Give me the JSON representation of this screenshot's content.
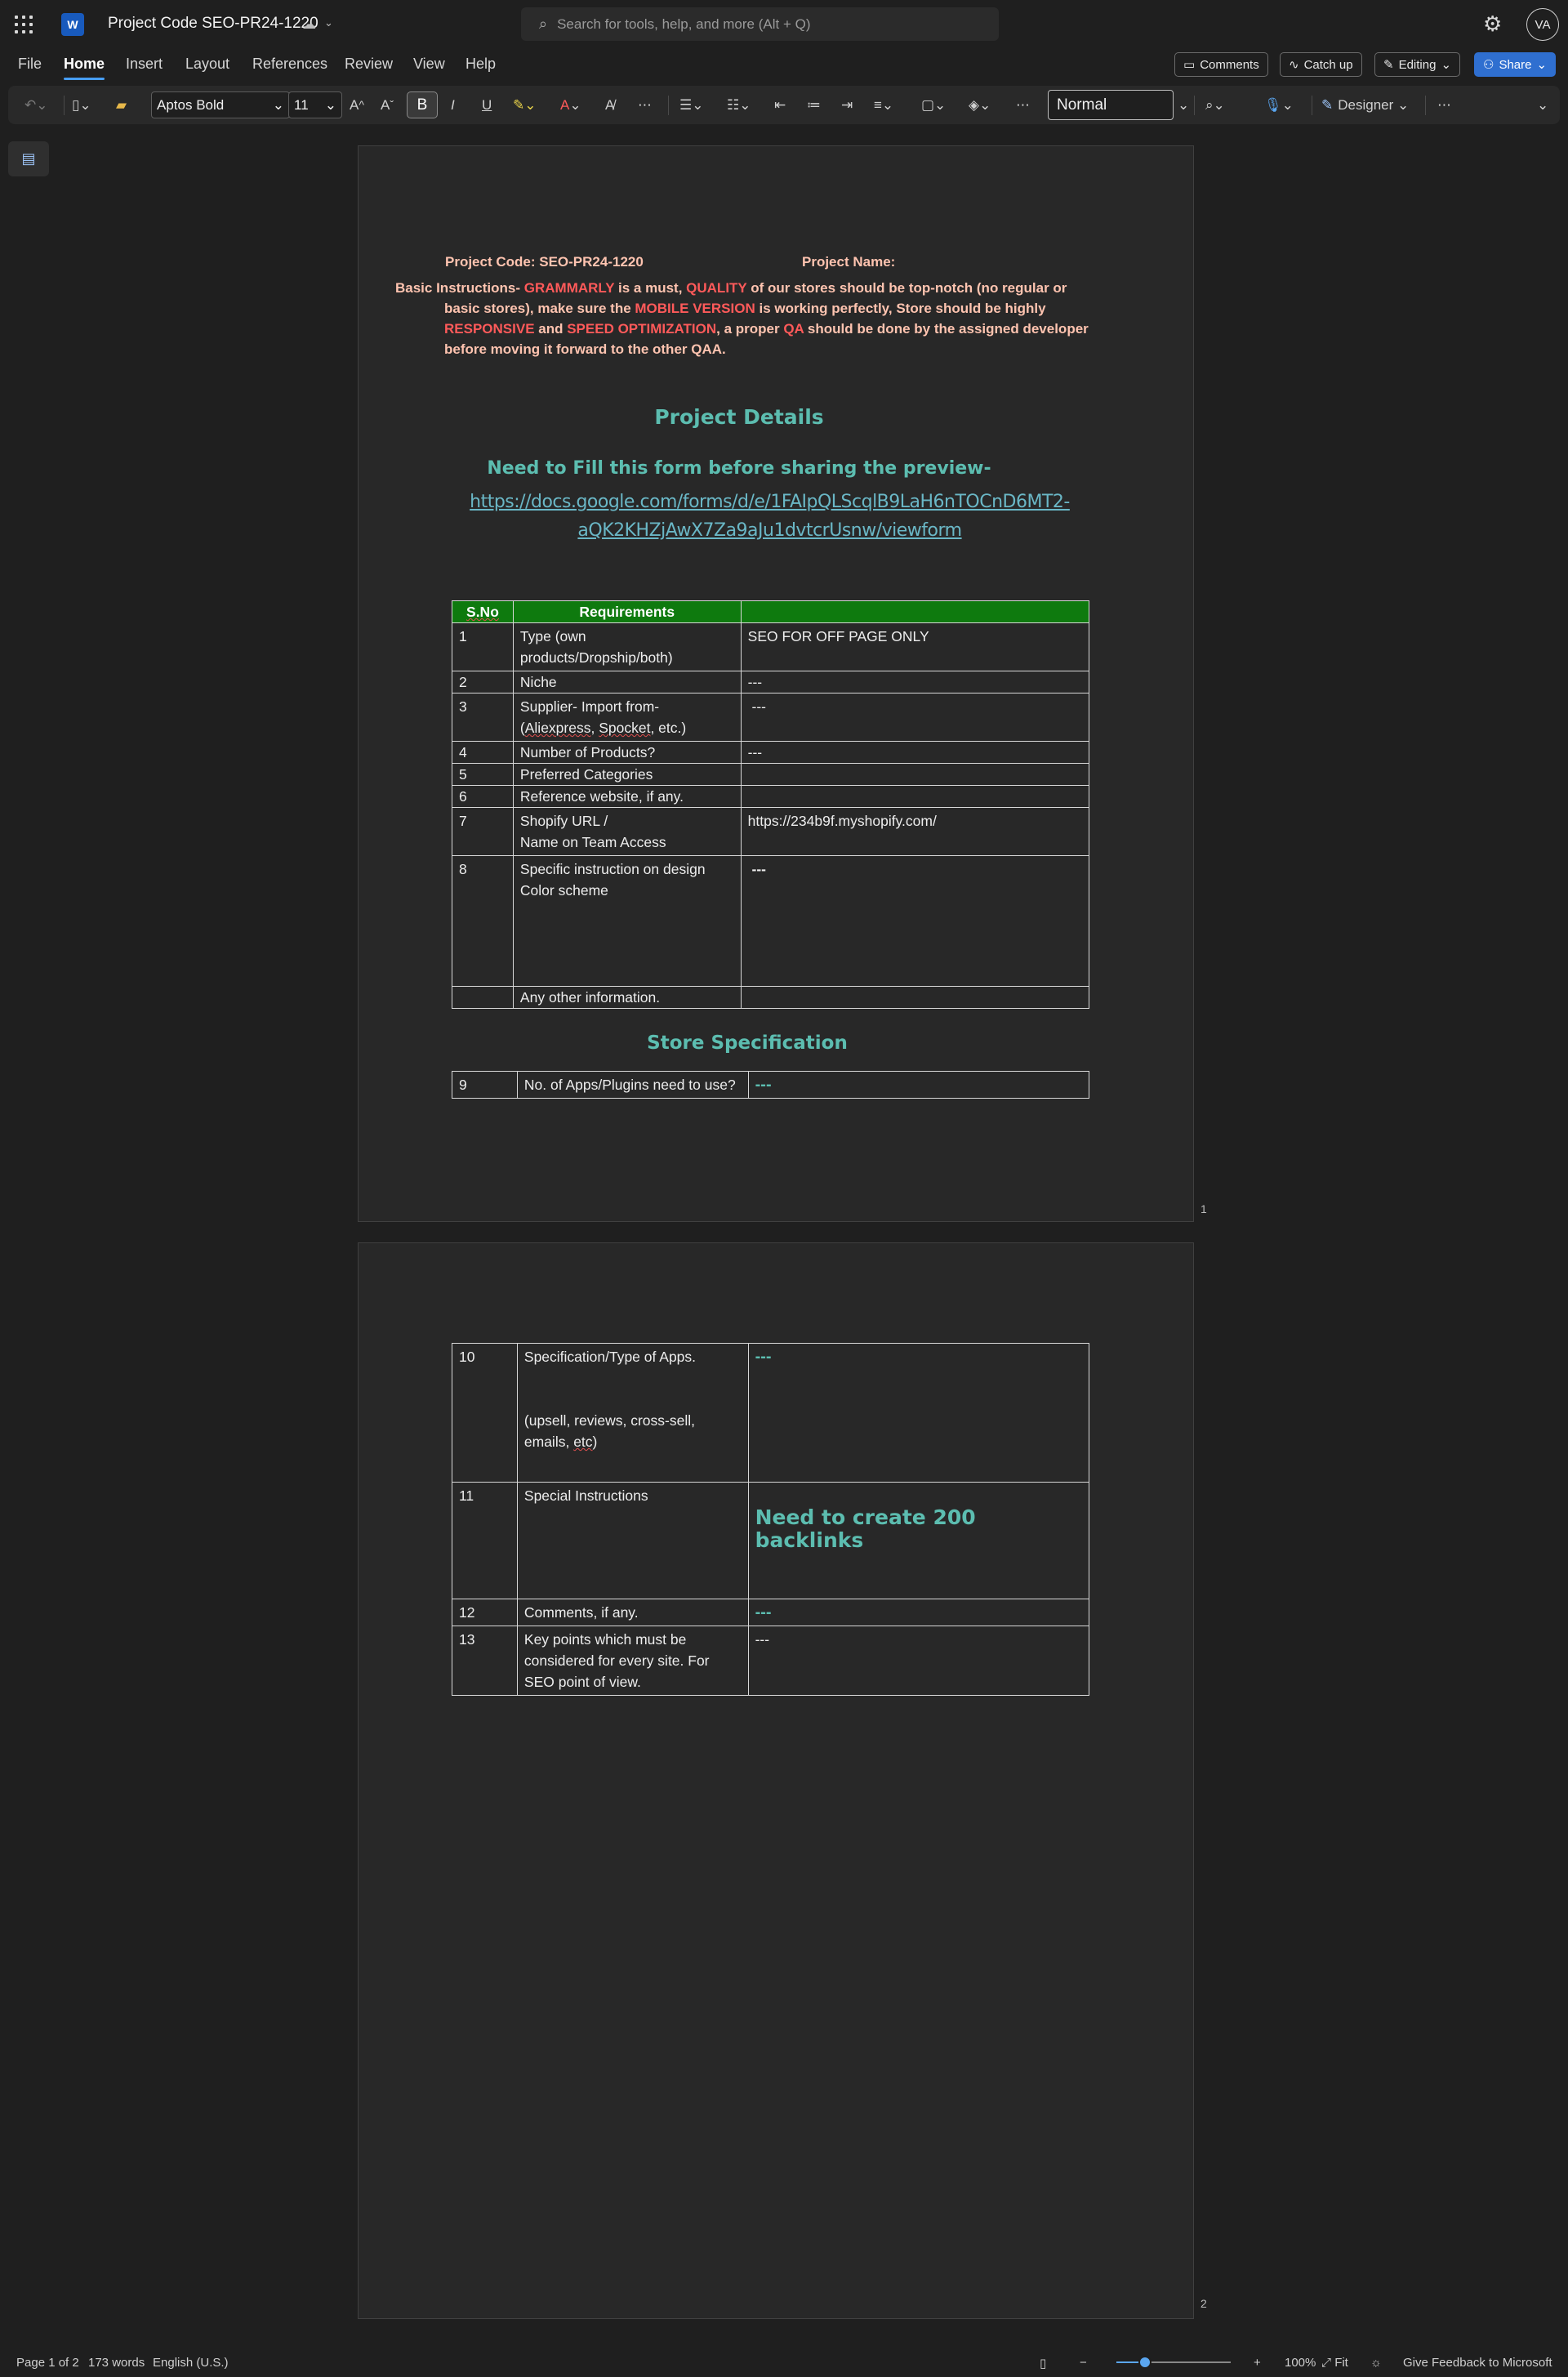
{
  "app": {
    "doc_title": "Project Code SEO-PR24-1220",
    "search_placeholder": "Search for tools, help, and more (Alt + Q)",
    "avatar_initials": "VA",
    "logo_letter": "W"
  },
  "menu": {
    "items": [
      "File",
      "Home",
      "Insert",
      "Layout",
      "References",
      "Review",
      "View",
      "Help"
    ],
    "active": "Home",
    "comments": "Comments",
    "catch_up": "Catch up",
    "editing": "Editing",
    "share": "Share"
  },
  "ribbon": {
    "font_name": "Aptos Bold",
    "font_size": "11",
    "style": "Normal",
    "designer": "Designer"
  },
  "page1": {
    "project_code_label": "Project Code: SEO-PR24-1220",
    "project_name_label": "Project Name:",
    "instructions": {
      "p1": "Basic Instructions- ",
      "k1": "GRAMMARLY",
      "p2": " is a must, ",
      "k2": "QUALITY",
      "p3": " of our stores should be top-notch (no regular or",
      "line2": "basic stores), make sure the ",
      "k3": "MOBILE VERSION",
      "p4": " is working perfectly, Store should be highly",
      "k4": "RESPONSIVE",
      "p5": " and ",
      "k5": "SPEED OPTIMIZATION",
      "p6": ", a proper ",
      "k6": "QA",
      "p7": " should be done by the assigned developer",
      "line4": "before moving it forward to the other QAA."
    },
    "project_details_heading": "Project Details",
    "fill_form_heading": "Need to Fill this form before sharing the preview-",
    "form_link_line1": "https://docs.google.com/forms/d/e/1FAIpQLScqlB9LaH6nTOCnD6MT2-",
    "form_link_line2": "aQK2KHZjAwX7Za9aJu1dvtcrUsnw/viewform",
    "table_headers": [
      "S.No",
      "Requirements",
      ""
    ],
    "rows": [
      {
        "no": "1",
        "req": "Type (own products/Dropship/both)",
        "val": "SEO FOR OFF PAGE ONLY"
      },
      {
        "no": "2",
        "req": "Niche",
        "val": "---"
      },
      {
        "no": "3",
        "req_a": "Supplier- Import from-",
        "req_b_1": "(",
        "req_b_2": "Aliexpress",
        "req_b_3": ", ",
        "req_b_4": "Spocket",
        "req_b_5": ", etc.)",
        "val": " ---"
      },
      {
        "no": "4",
        "req": "Number of Products?",
        "val": "---"
      },
      {
        "no": "5",
        "req": "Preferred Categories",
        "val": ""
      },
      {
        "no": "6",
        "req": "Reference website, if any.",
        "val": ""
      },
      {
        "no": "7",
        "req_a": "Shopify URL /",
        "req_b": "Name on Team Access",
        "val": "https://234b9f.myshopify.com/"
      },
      {
        "no": "8",
        "req_a": "Specific instruction on design",
        "req_b": "Color scheme",
        "val": " ---"
      },
      {
        "no": "",
        "req": "Any other information.",
        "val": ""
      }
    ],
    "store_spec_heading": "Store Specification",
    "spec_row": {
      "no": "9",
      "req": "No. of Apps/Plugins need to use?",
      "val": "---"
    },
    "page_number": "1"
  },
  "page2": {
    "rows": [
      {
        "no": "10",
        "req_a": "Specification/Type of Apps.",
        "req_b_1": "(upsell, reviews, cross-sell, emails, ",
        "req_b_2": "etc",
        "req_b_3": ")",
        "val": "---"
      },
      {
        "no": "11",
        "req": "Special Instructions",
        "val": "Need to create 200 backlinks"
      },
      {
        "no": "12",
        "req": "Comments, if any.",
        "val": "---"
      },
      {
        "no": "13",
        "req": "Key points which must be considered for every site. For SEO point of view.",
        "val": "---"
      }
    ],
    "page_number": "2"
  },
  "status": {
    "page": "Page 1 of 2",
    "words": "173 words",
    "language": "English (U.S.)",
    "zoom": "100%",
    "fit": "Fit",
    "feedback": "Give Feedback to Microsoft",
    "zoom_level": 0.25
  },
  "colors": {
    "accent": "#479ef5",
    "header_green": "#0e7a0e",
    "teal_heading": "#5cbdb0",
    "instruction_red": "#ff5a5a",
    "instruction_text": "#ffc4b0"
  },
  "icons": [
    "apps-grid-icon",
    "word-logo-icon",
    "cloud-saved-icon",
    "search-icon",
    "settings-gear-icon",
    "undo-icon",
    "clipboard-icon",
    "format-painter-icon",
    "bullets-icon",
    "numbering-icon",
    "align-icon",
    "borders-icon",
    "shading-icon",
    "find-icon",
    "dictate-mic-icon",
    "designer-icon",
    "more-icon",
    "navigation-pane-icon"
  ]
}
